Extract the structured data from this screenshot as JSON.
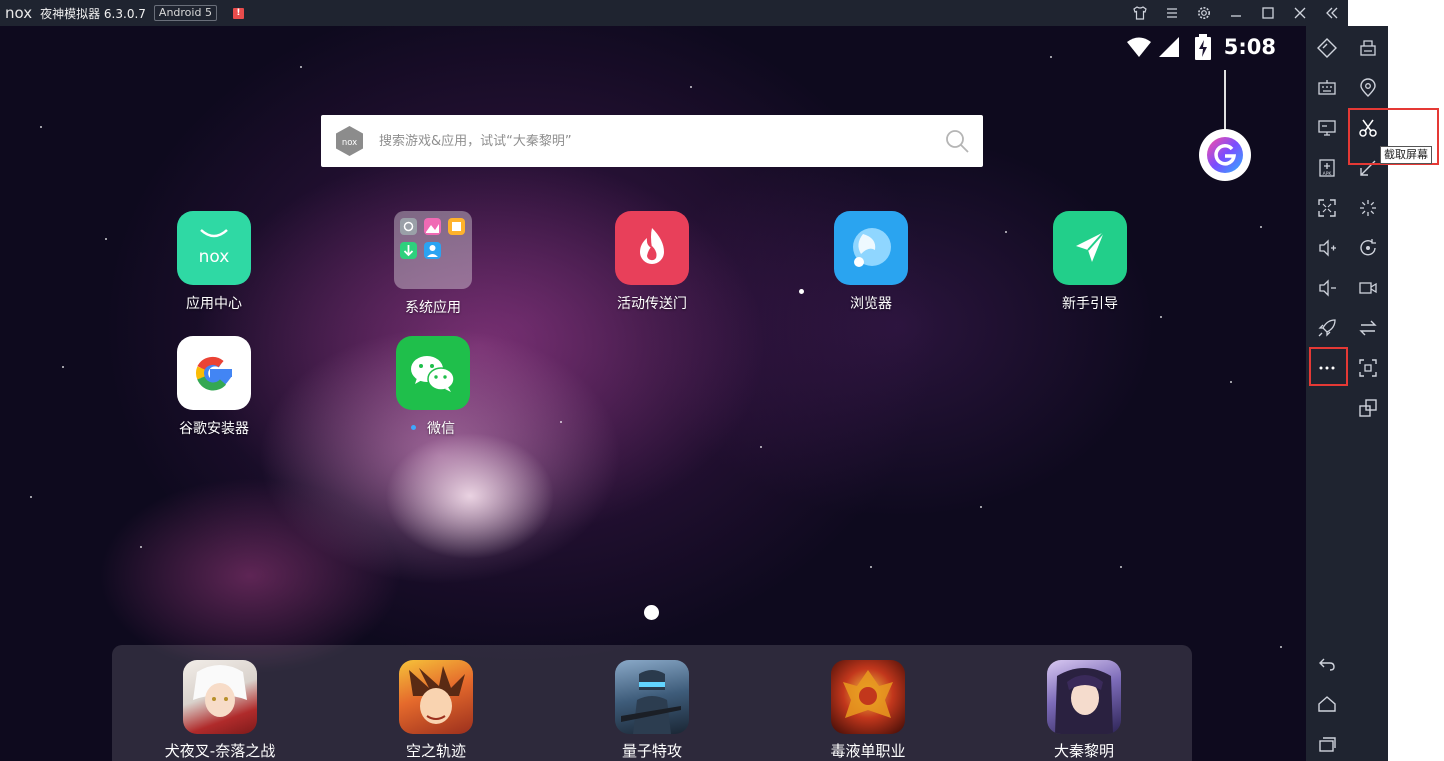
{
  "window": {
    "title": "夜神模拟器 6.3.0.7",
    "logo": "nox",
    "android_badge": "Android 5",
    "alert": "!"
  },
  "status_bar": {
    "time": "5:08"
  },
  "search": {
    "placeholder": "搜索游戏&应用，试试“大秦黎明”"
  },
  "apps": [
    {
      "label": "应用中心"
    },
    {
      "label": "系统应用"
    },
    {
      "label": "活动传送门"
    },
    {
      "label": "浏览器"
    },
    {
      "label": "新手引导"
    },
    {
      "label": "谷歌安装器"
    },
    {
      "label": "微信"
    }
  ],
  "dock": [
    {
      "label": "犬夜叉-奈落之战"
    },
    {
      "label": "空之轨迹"
    },
    {
      "label": "量子特攻"
    },
    {
      "label": "毒液单职业"
    },
    {
      "label": "大秦黎明"
    }
  ],
  "tooltip": {
    "text": "截取屏幕"
  },
  "colors": {
    "titlebar": "#1f2430",
    "highlight": "#e53935",
    "app_center": "#2fd9a4",
    "activity": "#e8405a",
    "browser": "#2aa4f0",
    "guide": "#22cf8a",
    "wechat": "#1fbf4b"
  }
}
